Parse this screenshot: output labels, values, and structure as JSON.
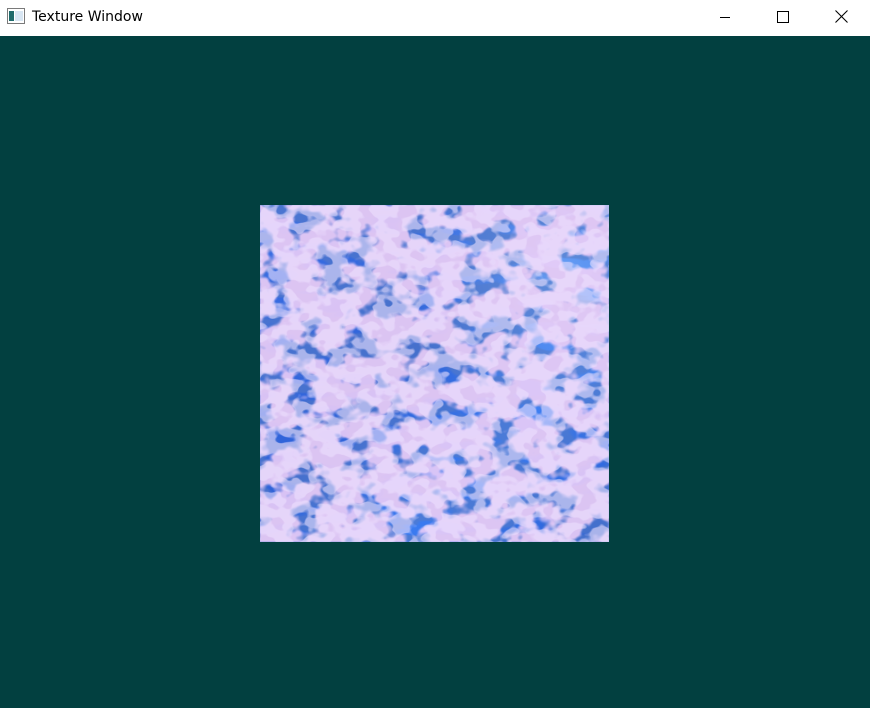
{
  "window": {
    "title": "Texture Window",
    "icon": "app-window-icon"
  },
  "caption_buttons": {
    "minimize": "minimize-icon",
    "maximize": "maximize-icon",
    "close": "close-icon"
  },
  "colors": {
    "titlebar": "#ffffff",
    "clear_color": "#024040",
    "texture_base": "#2f6fe6",
    "texture_highlight": "#e7a6e8"
  },
  "scene": {
    "texture": "water-caustics-texture"
  }
}
